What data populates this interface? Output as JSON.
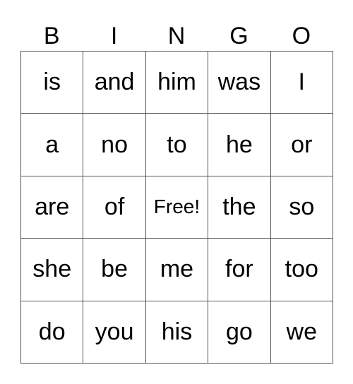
{
  "header": [
    "B",
    "I",
    "N",
    "G",
    "O"
  ],
  "grid": [
    [
      "is",
      "and",
      "him",
      "was",
      "I"
    ],
    [
      "a",
      "no",
      "to",
      "he",
      "or"
    ],
    [
      "are",
      "of",
      "Free!",
      "the",
      "so"
    ],
    [
      "she",
      "be",
      "me",
      "for",
      "too"
    ],
    [
      "do",
      "you",
      "his",
      "go",
      "we"
    ]
  ],
  "free_cell": "Free!"
}
